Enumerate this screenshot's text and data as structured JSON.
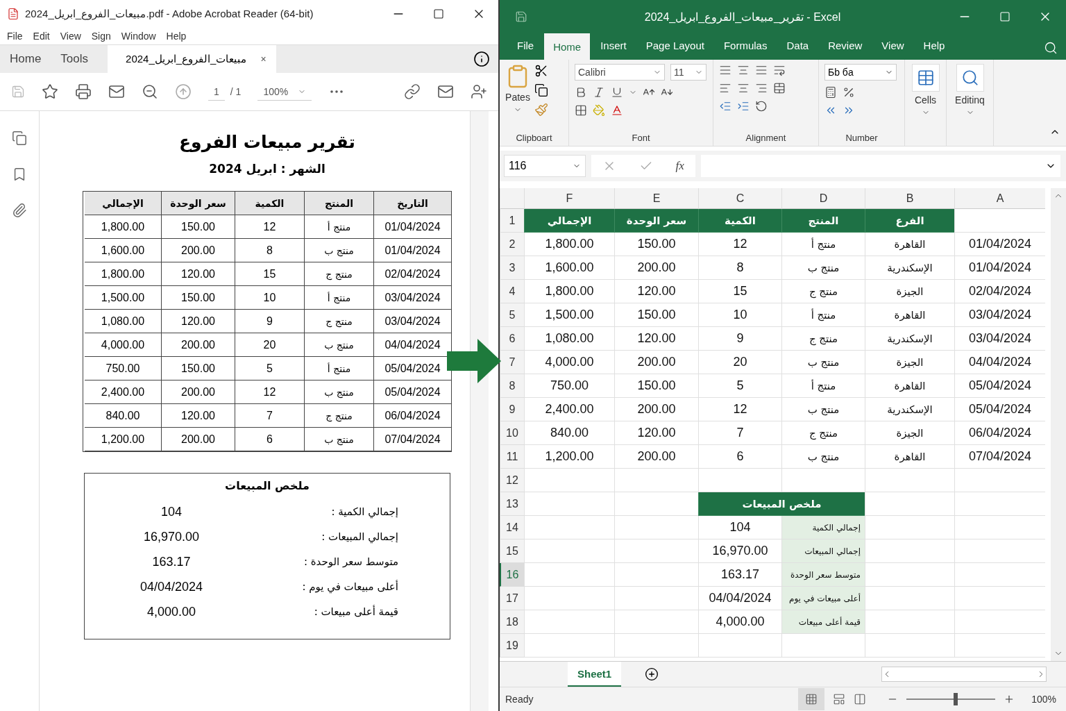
{
  "acrobat": {
    "title": "مبيعات_الفروع_ابريل_2024.pdf - Adobe Acrobat Reader (64-bit)",
    "menu": [
      "Help",
      "Window",
      "Sign",
      "View",
      "Edit",
      "File"
    ],
    "tabs": [
      {
        "label": "Tools",
        "selected": false
      },
      {
        "label": "Home",
        "selected": false
      }
    ],
    "doc_tab": {
      "label": "مبيعات_الفروع_ابريل_2024",
      "close": "×",
      "selected": true
    },
    "toolbar": {
      "page": "1",
      "pages": "/ 1",
      "zoom": "100%"
    },
    "document": {
      "title": "تقرير مبيعات الفروع",
      "subtitle": "الشهر : ابريل 2024",
      "columns": [
        "التاريخ",
        "المنتج",
        "الكمية",
        "سعر الوحدة",
        "الإجمالي"
      ],
      "rows": [
        [
          "01/04/2024",
          "منتج أ",
          "12",
          "150.00",
          "1,800.00"
        ],
        [
          "01/04/2024",
          "منتج ب",
          "8",
          "200.00",
          "1,600.00"
        ],
        [
          "02/04/2024",
          "منتج ج",
          "15",
          "120.00",
          "1,800.00"
        ],
        [
          "03/04/2024",
          "منتج أ",
          "10",
          "150.00",
          "1,500.00"
        ],
        [
          "03/04/2024",
          "منتج ج",
          "9",
          "120.00",
          "1,080.00"
        ],
        [
          "04/04/2024",
          "منتج ب",
          "20",
          "200.00",
          "4,000.00"
        ],
        [
          "05/04/2024",
          "منتج أ",
          "5",
          "150.00",
          "750.00"
        ],
        [
          "05/04/2024",
          "منتج ب",
          "12",
          "200.00",
          "2,400.00"
        ],
        [
          "06/04/2024",
          "منتج ج",
          "7",
          "120.00",
          "840.00"
        ],
        [
          "07/04/2024",
          "منتج ب",
          "6",
          "200.00",
          "1,200.00"
        ]
      ],
      "summary": {
        "title": "ملخص المبيعات",
        "rows": [
          {
            "label": "إجمالي الكمية :",
            "value": "104"
          },
          {
            "label": "إجمالي المبيعات :",
            "value": "16,970.00"
          },
          {
            "label": "متوسط سعر الوحدة :",
            "value": "163.17"
          },
          {
            "label": "أعلى مبيعات في يوم :",
            "value": "04/04/2024"
          },
          {
            "label": "قيمة أعلى مبيعات :",
            "value": "4,000.00"
          }
        ]
      }
    }
  },
  "excel": {
    "title": "تقرير_مبيعات_الفروع_ابريل_2024 - Excel",
    "ribbon_tabs": [
      {
        "label": "Help",
        "selected": false
      },
      {
        "label": "View",
        "selected": false
      },
      {
        "label": "Review",
        "selected": false
      },
      {
        "label": "Data",
        "selected": false
      },
      {
        "label": "Formulas",
        "selected": false
      },
      {
        "label": "Page Layout",
        "selected": false
      },
      {
        "label": "Insert",
        "selected": false
      },
      {
        "label": "Home",
        "selected": true
      },
      {
        "label": "File",
        "selected": false
      }
    ],
    "ribbon": {
      "paste": "Pates",
      "font": "Calibri",
      "size": "11",
      "number_format": "Бb бa",
      "cells": "Cells",
      "editing": "Editinq",
      "groups": [
        "Number",
        "Alignment",
        "Font",
        "Clipboart"
      ]
    },
    "name_box": "116",
    "fx": "fx",
    "columns": [
      "A",
      "B",
      "D",
      "C",
      "E",
      "F"
    ],
    "rows": [
      {
        "num": "1",
        "selected": false,
        "kind": "header",
        "cells": [
          "الفرع",
          "المنتج",
          "الكمية",
          "سعر الوحدة",
          "الإجمالي"
        ]
      },
      {
        "num": "2",
        "selected": false,
        "kind": "data",
        "cells": [
          "01/04/2024",
          "القاهرة",
          "منتج أ",
          "12",
          "150.00",
          "1,800.00"
        ]
      },
      {
        "num": "3",
        "selected": false,
        "kind": "data",
        "cells": [
          "01/04/2024",
          "الإسكندرية",
          "منتج ب",
          "8",
          "200.00",
          "1,600.00"
        ]
      },
      {
        "num": "4",
        "selected": false,
        "kind": "data",
        "cells": [
          "02/04/2024",
          "الجيزة",
          "منتج ج",
          "15",
          "120.00",
          "1,800.00"
        ]
      },
      {
        "num": "5",
        "selected": false,
        "kind": "data",
        "cells": [
          "03/04/2024",
          "القاهرة",
          "منتج أ",
          "10",
          "150.00",
          "1,500.00"
        ]
      },
      {
        "num": "6",
        "selected": false,
        "kind": "data",
        "cells": [
          "03/04/2024",
          "الإسكندرية",
          "منتج ج",
          "9",
          "120.00",
          "1,080.00"
        ]
      },
      {
        "num": "7",
        "selected": false,
        "kind": "data",
        "cells": [
          "04/04/2024",
          "الجيزة",
          "منتج ب",
          "20",
          "200.00",
          "4,000.00"
        ]
      },
      {
        "num": "8",
        "selected": false,
        "kind": "data",
        "cells": [
          "05/04/2024",
          "القاهرة",
          "منتج أ",
          "5",
          "150.00",
          "750.00"
        ]
      },
      {
        "num": "9",
        "selected": false,
        "kind": "data",
        "cells": [
          "05/04/2024",
          "الإسكندرية",
          "منتج ب",
          "12",
          "200.00",
          "2,400.00"
        ]
      },
      {
        "num": "10",
        "selected": false,
        "kind": "data",
        "cells": [
          "06/04/2024",
          "الجيزة",
          "منتج ج",
          "7",
          "120.00",
          "840.00"
        ]
      },
      {
        "num": "11",
        "selected": false,
        "kind": "data",
        "cells": [
          "07/04/2024",
          "القاهرة",
          "منتج ب",
          "6",
          "200.00",
          "1,200.00"
        ]
      },
      {
        "num": "12",
        "selected": false,
        "kind": "empty"
      },
      {
        "num": "13",
        "selected": false,
        "kind": "summary_title",
        "title": "ملخص المبيعات"
      },
      {
        "num": "14",
        "selected": false,
        "kind": "summary",
        "label": "إجمالي الكمية",
        "value": "104"
      },
      {
        "num": "15",
        "selected": false,
        "kind": "summary",
        "label": "إجمالي المبيعات",
        "value": "16,970.00"
      },
      {
        "num": "16",
        "selected": true,
        "kind": "summary",
        "label": "متوسط سعر الوحدة",
        "value": "163.17"
      },
      {
        "num": "17",
        "selected": false,
        "kind": "summary",
        "label": "أعلى مبيعات في يوم",
        "value": "04/04/2024"
      },
      {
        "num": "18",
        "selected": false,
        "kind": "summary",
        "label": "قيمة أعلى مبيعات",
        "value": "4,000.00"
      },
      {
        "num": "19",
        "selected": false,
        "kind": "empty"
      }
    ],
    "sheets": [
      {
        "label": "Sheet1",
        "selected": true
      }
    ],
    "status": "Ready",
    "zoom": {
      "level": 0.55,
      "reading": "100%"
    }
  }
}
